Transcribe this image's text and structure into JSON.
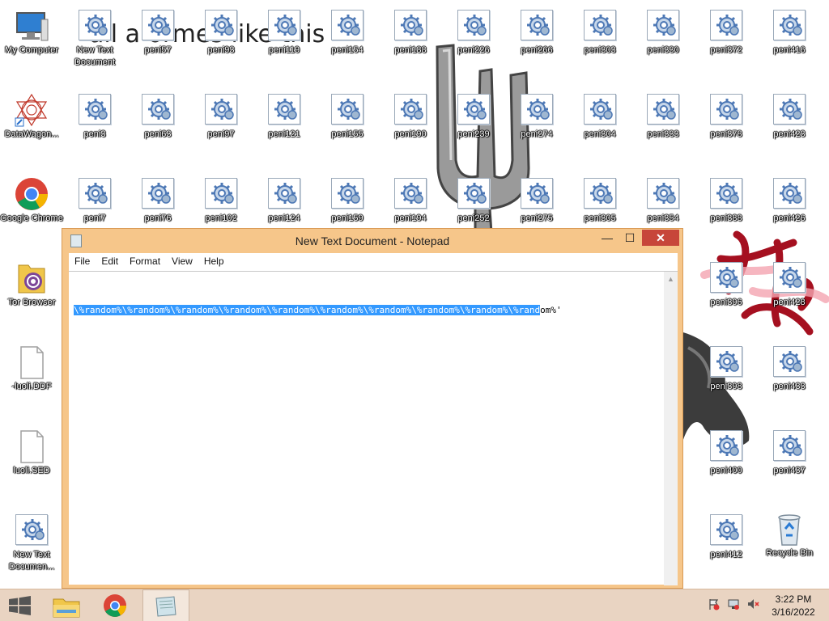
{
  "wallpaper": {
    "text": "all a   ormes like this"
  },
  "desktop": {
    "left_icons": [
      {
        "label": "My Computer",
        "icon": "computer-icon"
      },
      {
        "label": "DataWagon...",
        "icon": "datawagon-icon"
      },
      {
        "label": "Google Chrome",
        "icon": "chrome-icon"
      },
      {
        "label": "Tor Browser",
        "icon": "tor-browser-icon"
      },
      {
        "label": "-luoli.DDF",
        "icon": "file-icon"
      },
      {
        "label": "luoli.SED",
        "icon": "file-icon"
      },
      {
        "label": "New Text Documen...",
        "icon": "system-file-icon"
      }
    ],
    "grid_icons": [
      "New Text Document",
      "peni57",
      "peni93",
      "peni119",
      "peni154",
      "peni188",
      "peni226",
      "peni266",
      "peni303",
      "peni330",
      "peni372",
      "peni416",
      "peni3",
      "peni63",
      "peni97",
      "peni121",
      "peni155",
      "peni190",
      "peni239",
      "peni274",
      "peni304",
      "peni333",
      "peni378",
      "peni423",
      "peni7",
      "peni76",
      "peni102",
      "peni124",
      "peni159",
      "peni194",
      "peni252",
      "peni275",
      "peni305",
      "peni354",
      "peni388",
      "peni426",
      "peni396",
      "peni428",
      "peni398",
      "peni433",
      "peni400",
      "peni437",
      "peni412"
    ],
    "recycle_bin": "Recycle Bin"
  },
  "notepad": {
    "title": "New Text Document - Notepad",
    "menu": [
      "File",
      "Edit",
      "Format",
      "View",
      "Help"
    ],
    "content_selected": "\\%random%\\%random%\\%random%\\%random%\\%random%\\%random%\\%random%\\%random%\\%random%\\%rand",
    "content_rest": "om%'",
    "buttons": {
      "minimize": "—",
      "maximize": "☐",
      "close": "✕"
    }
  },
  "taskbar": {
    "items": [
      "start",
      "file-explorer",
      "google-chrome",
      "notepad"
    ],
    "clock": {
      "time": "3:22 PM",
      "date": "3/16/2022"
    }
  },
  "colors": {
    "selection": "#3399ff",
    "window_frame": "#f6c68a",
    "close_button": "#c7463a",
    "taskbar": "#e9d4c2"
  }
}
